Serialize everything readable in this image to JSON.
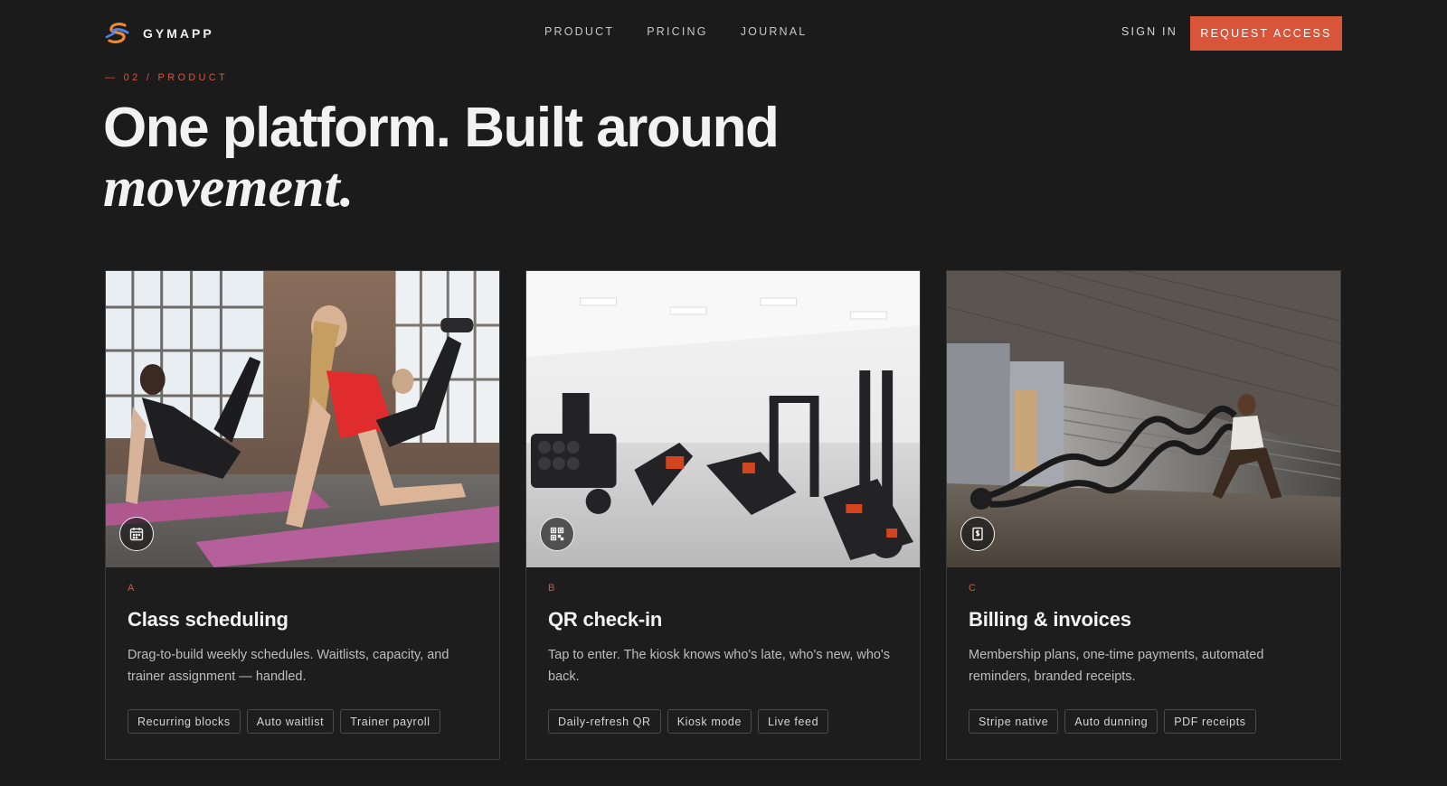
{
  "brand": {
    "name": "GYMAPP",
    "logo_icon": "gymapp-logo-icon"
  },
  "nav": {
    "items": [
      {
        "label": "PRODUCT"
      },
      {
        "label": "PRICING"
      },
      {
        "label": "JOURNAL"
      }
    ],
    "sign_in": "SIGN IN",
    "cta": "REQUEST ACCESS"
  },
  "colors": {
    "background": "#1b1b1b",
    "accent": "#d9553a",
    "text": "#f2f2f2",
    "muted": "#bdbdbd",
    "border": "#3a3a3a"
  },
  "hero": {
    "eyebrow": "— 02 / PRODUCT",
    "headline_line1": "One platform. Built around",
    "headline_line2": "movement."
  },
  "cards": [
    {
      "letter": "A",
      "title": "Class scheduling",
      "description": "Drag-to-build weekly schedules. Waitlists, capacity, and trainer assignment — handled.",
      "icon": "calendar-icon",
      "photo": "women exercising on mats in brick studio",
      "tags": [
        "Recurring blocks",
        "Auto waitlist",
        "Trainer payroll"
      ]
    },
    {
      "letter": "B",
      "title": "QR check-in",
      "description": "Tap to enter. The kiosk knows who's late, who's new, who's back.",
      "icon": "qr-code-icon",
      "photo": "bright gym floor with equipment",
      "tags": [
        "Daily-refresh QR",
        "Kiosk mode",
        "Live feed"
      ]
    },
    {
      "letter": "C",
      "title": "Billing & invoices",
      "description": "Membership plans, one-time payments, automated reminders, branded receipts.",
      "icon": "invoice-dollar-icon",
      "photo": "man training with battle ropes",
      "tags": [
        "Stripe native",
        "Auto dunning",
        "PDF receipts"
      ]
    }
  ]
}
